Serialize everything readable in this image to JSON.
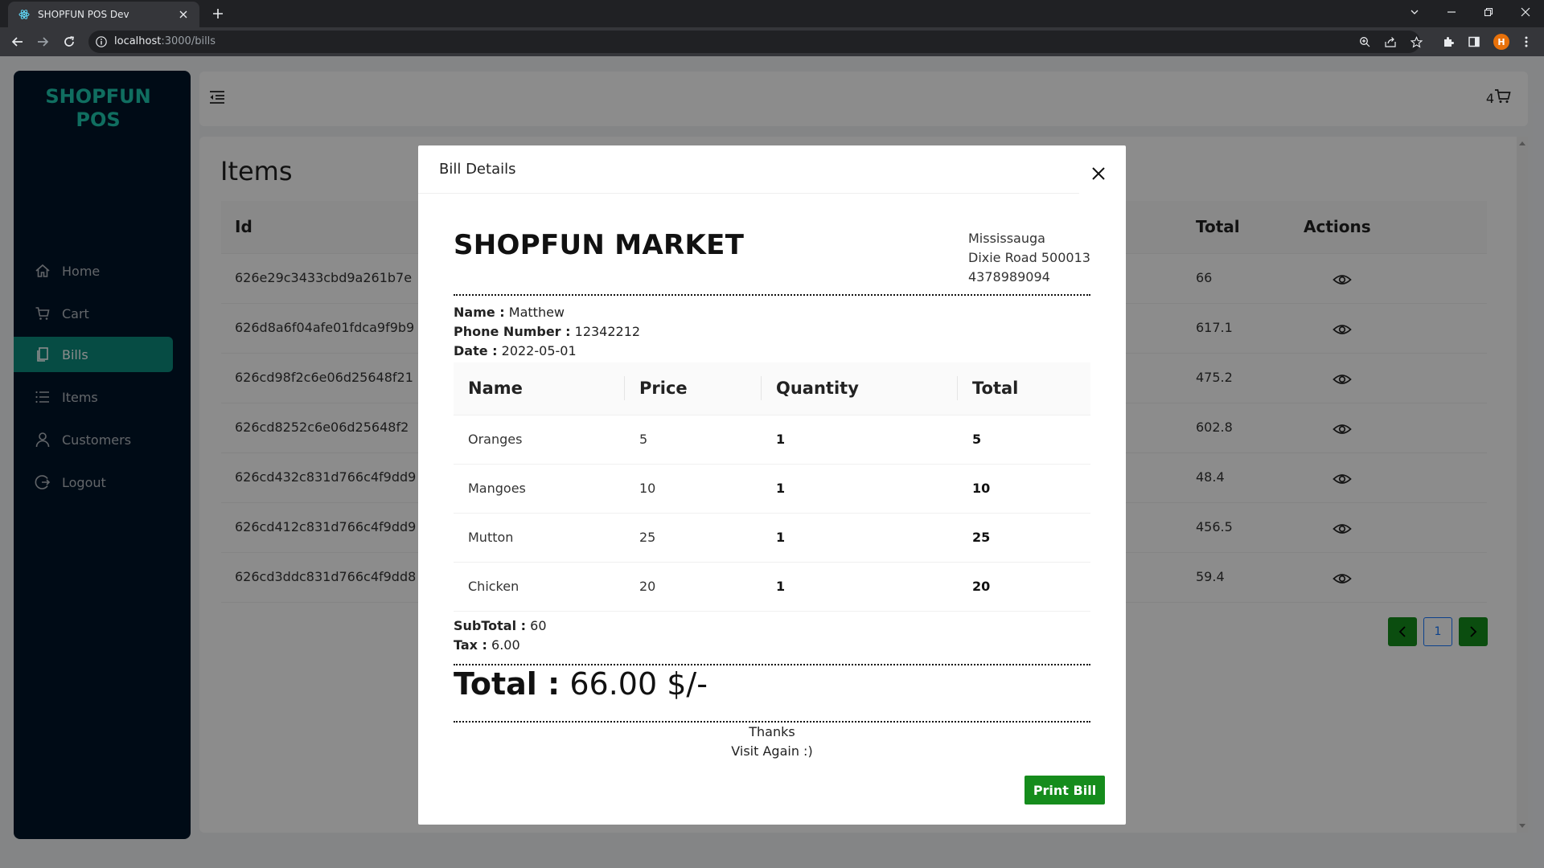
{
  "browser": {
    "tab_title": "SHOPFUN POS Dev",
    "url_host": "localhost",
    "url_path": ":3000/bills"
  },
  "sidebar": {
    "logo_line1": "SHOPFUN",
    "logo_line2": "POS",
    "items": [
      {
        "label": "Home",
        "icon": "home-icon"
      },
      {
        "label": "Cart",
        "icon": "cart-icon"
      },
      {
        "label": "Bills",
        "icon": "bills-icon",
        "active": true
      },
      {
        "label": "Items",
        "icon": "list-icon"
      },
      {
        "label": "Customers",
        "icon": "user-icon"
      },
      {
        "label": "Logout",
        "icon": "logout-icon"
      }
    ]
  },
  "header": {
    "cart_count": "4"
  },
  "content": {
    "title": "Items",
    "columns": {
      "id": "Id",
      "total": "Total",
      "actions": "Actions"
    },
    "rows": [
      {
        "id": "626e29c3433cbd9a261b7e",
        "total": "66"
      },
      {
        "id": "626d8a6f04afe01fdca9f9b9",
        "total": "617.1"
      },
      {
        "id": "626cd98f2c6e06d25648f21",
        "total": "475.2"
      },
      {
        "id": "626cd8252c6e06d25648f2",
        "total": "602.8"
      },
      {
        "id": "626cd432c831d766c4f9dd9",
        "total": "48.4"
      },
      {
        "id": "626cd412c831d766c4f9dd9",
        "total": "456.5"
      },
      {
        "id": "626cd3ddc831d766c4f9dd8",
        "total": "59.4"
      }
    ],
    "page": "1"
  },
  "modal": {
    "title": "Bill Details",
    "store_name": "SHOPFUN MARKET",
    "address": [
      "Mississauga",
      "Dixie Road 500013",
      "4378989094"
    ],
    "name_label": "Name :",
    "name_value": "Matthew",
    "phone_label": "Phone Number :",
    "phone_value": "12342212",
    "date_label": "Date :",
    "date_value": "2022-05-01",
    "columns": [
      "Name",
      "Price",
      "Quantity",
      "Total"
    ],
    "items": [
      {
        "name": "Oranges",
        "price": "5",
        "quantity": "1",
        "total": "5"
      },
      {
        "name": "Mangoes",
        "price": "10",
        "quantity": "1",
        "total": "10"
      },
      {
        "name": "Mutton",
        "price": "25",
        "quantity": "1",
        "total": "25"
      },
      {
        "name": "Chicken",
        "price": "20",
        "quantity": "1",
        "total": "20"
      }
    ],
    "subtotal_label": "SubTotal :",
    "subtotal_value": "60",
    "tax_label": "Tax :",
    "tax_value": "6.00",
    "total_label": "Total :",
    "total_value": "66.00 $/-",
    "thanks": "Thanks",
    "visit_again": "Visit Again :)",
    "print_label": "Print Bill"
  },
  "colors": {
    "sidebar_bg": "#001529",
    "logo": "#1ec8b0",
    "active_item": "#0b8a7d",
    "button_green": "#158c1c"
  }
}
